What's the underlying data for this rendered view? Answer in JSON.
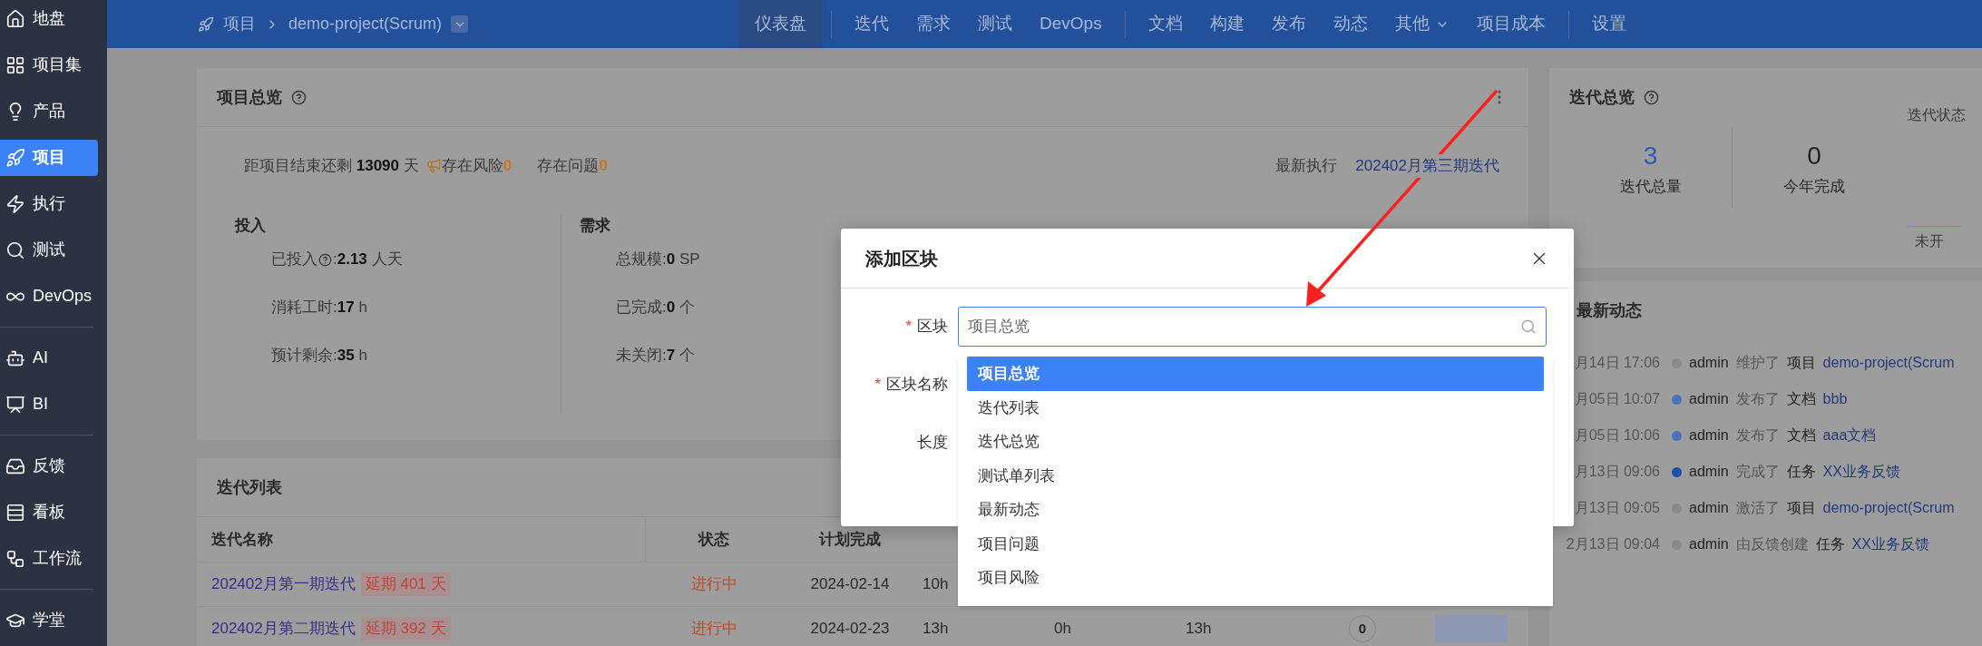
{
  "sidebar": {
    "groups": [
      {
        "items": [
          {
            "label": "地盘",
            "selected": false
          },
          {
            "label": "项目集",
            "selected": false
          },
          {
            "label": "产品",
            "selected": false
          },
          {
            "label": "项目",
            "selected": true
          },
          {
            "label": "执行",
            "selected": false
          },
          {
            "label": "测试",
            "selected": false
          },
          {
            "label": "DevOps",
            "selected": false
          }
        ]
      },
      {
        "items": [
          {
            "label": "AI",
            "selected": false
          },
          {
            "label": "BI",
            "selected": false
          }
        ]
      },
      {
        "items": [
          {
            "label": "反馈",
            "selected": false
          },
          {
            "label": "看板",
            "selected": false
          },
          {
            "label": "工作流",
            "selected": false
          }
        ]
      },
      {
        "items": [
          {
            "label": "学堂",
            "selected": false
          }
        ]
      }
    ]
  },
  "topbar": {
    "breadcrumb": {
      "parent": "项目",
      "project": "demo-project(Scrum)"
    },
    "nav": [
      [
        {
          "label": "仪表盘",
          "selected": true,
          "has_menu": false
        }
      ],
      [
        {
          "label": "迭代",
          "selected": false,
          "has_menu": false
        },
        {
          "label": "需求",
          "selected": false,
          "has_menu": false
        },
        {
          "label": "测试",
          "selected": false,
          "has_menu": false
        },
        {
          "label": "DevOps",
          "selected": false,
          "has_menu": false
        }
      ],
      [
        {
          "label": "文档",
          "selected": false,
          "has_menu": false
        },
        {
          "label": "构建",
          "selected": false,
          "has_menu": false
        },
        {
          "label": "发布",
          "selected": false,
          "has_menu": false
        },
        {
          "label": "动态",
          "selected": false,
          "has_menu": false
        },
        {
          "label": "其他",
          "selected": false,
          "has_menu": true
        },
        {
          "label": "项目成本",
          "selected": false,
          "has_menu": false
        }
      ],
      [
        {
          "label": "设置",
          "selected": false,
          "has_menu": false
        }
      ]
    ]
  },
  "overview": {
    "title": "项目总览",
    "separator": ":",
    "countdown": {
      "prefix": "距项目结束还剩",
      "days": "13090",
      "unit": "天"
    },
    "risk": {
      "label": "存在风险",
      "count": "0"
    },
    "issues": {
      "label": "存在问题",
      "count": "0"
    },
    "latest": {
      "label": "最新执行",
      "value": "202402月第三期迭代"
    },
    "sections": [
      {
        "title": "投入",
        "rows": [
          {
            "label": "已投入",
            "help": true,
            "value": "2.13",
            "unit": "人天"
          },
          {
            "label": "消耗工时",
            "help": false,
            "value": "17",
            "unit": "h"
          },
          {
            "label": "预计剩余",
            "help": false,
            "value": "35",
            "unit": "h"
          }
        ]
      },
      {
        "title": "需求",
        "rows": [
          {
            "label": "总规模",
            "help": false,
            "value": "0",
            "unit": "SP"
          },
          {
            "label": "已完成",
            "help": false,
            "value": "0",
            "unit": "个"
          },
          {
            "label": "未关闭",
            "help": false,
            "value": "7",
            "unit": "个"
          }
        ]
      }
    ]
  },
  "iterations": {
    "title": "迭代列表",
    "columns": [
      "迭代名称",
      "状态",
      "计划完成"
    ],
    "rows": [
      {
        "cells": [
          {
            "kind": "name",
            "text": "202402月第一期迭代",
            "tag": "延期 401 天"
          },
          {
            "kind": "status",
            "text": "进行中"
          },
          {
            "kind": "plain",
            "text": "2024-02-14"
          },
          {
            "kind": "plain",
            "text": "10h"
          }
        ]
      },
      {
        "cells": [
          {
            "kind": "name",
            "text": "202402月第二期迭代",
            "tag": "延期 392 天"
          },
          {
            "kind": "status",
            "text": "进行中"
          },
          {
            "kind": "plain",
            "text": "2024-02-23"
          },
          {
            "kind": "plain",
            "text": "13h"
          },
          {
            "kind": "plain",
            "text": "0h"
          },
          {
            "kind": "plain",
            "text": "13h"
          },
          {
            "kind": "count",
            "text": "0"
          },
          {
            "kind": "chart"
          }
        ]
      }
    ]
  },
  "iteration_overview": {
    "title": "迭代总览",
    "stats": [
      {
        "value": "3",
        "label": "迭代总量",
        "highlight": true
      },
      {
        "value": "0",
        "label": "今年完成",
        "highlight": false
      }
    ],
    "status_label": "迭代状态",
    "legend": "未开"
  },
  "activity": {
    "title": "最新动态",
    "items": [
      {
        "time": "月14日 17:06",
        "color": "#8a8a8a",
        "user": "admin",
        "action": "维护了",
        "type": "项目",
        "target": "demo-project(Scrum"
      },
      {
        "time": "月05日 10:07",
        "color": "#4a74b8",
        "user": "admin",
        "action": "发布了",
        "type": "文档",
        "target": "bbb"
      },
      {
        "time": "月05日 10:06",
        "color": "#4a74b8",
        "user": "admin",
        "action": "发布了",
        "type": "文档",
        "target": "aaa文档"
      },
      {
        "time": "月13日 09:06",
        "color": "#1f4fa8",
        "user": "admin",
        "action": "完成了",
        "type": "任务",
        "target": "XX业务反馈"
      },
      {
        "time": "月13日 09:05",
        "color": "#8a8a8a",
        "user": "admin",
        "action": "激活了",
        "type": "项目",
        "target": "demo-project(Scrum"
      },
      {
        "time": "2月13日 09:04",
        "color": "#8a8a8a",
        "user": "admin",
        "action": "由反馈创建",
        "type": "任务",
        "target": "XX业务反馈"
      }
    ]
  },
  "dialog": {
    "title": "添加区块",
    "required_mark": "*",
    "fields": [
      {
        "label": "区块",
        "required": true
      },
      {
        "label": "区块名称",
        "required": true
      },
      {
        "label": "长度",
        "required": false
      }
    ],
    "block_value": "项目总览",
    "options": [
      {
        "label": "项目总览",
        "selected": true
      },
      {
        "label": "迭代列表",
        "selected": false
      },
      {
        "label": "迭代总览",
        "selected": false
      },
      {
        "label": "测试单列表",
        "selected": false
      },
      {
        "label": "最新动态",
        "selected": false
      },
      {
        "label": "项目问题",
        "selected": false
      },
      {
        "label": "项目风险",
        "selected": false
      }
    ]
  }
}
